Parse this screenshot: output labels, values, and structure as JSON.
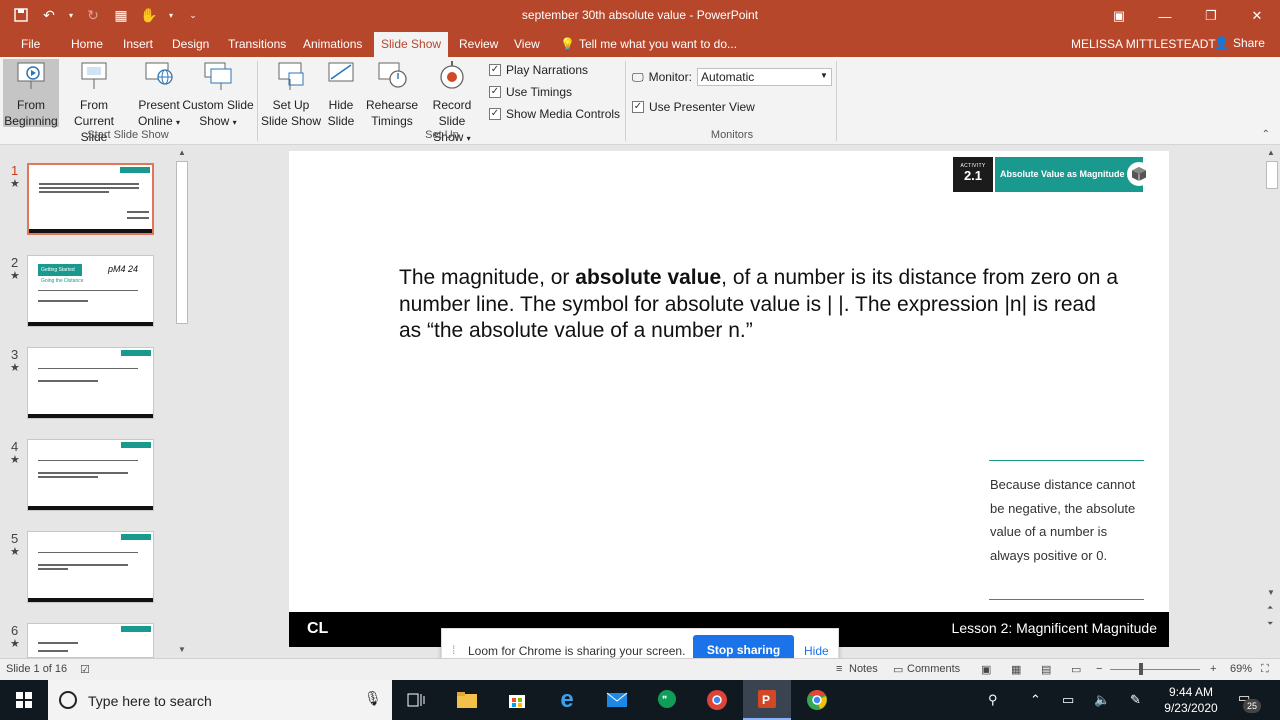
{
  "window": {
    "title": "september 30th absolute value - PowerPoint"
  },
  "menu": {
    "tabs": [
      "File",
      "Home",
      "Insert",
      "Design",
      "Transitions",
      "Animations",
      "Slide Show",
      "Review",
      "View"
    ],
    "active_tab": "Slide Show",
    "tell_me": "Tell me what you want to do...",
    "user": "MELISSA MITTLESTEADT",
    "share": "Share"
  },
  "ribbon": {
    "start": {
      "from_beginning": [
        "From",
        "Beginning"
      ],
      "from_current": [
        "From",
        "Current Slide"
      ],
      "present_online": [
        "Present",
        "Online"
      ],
      "custom_show": [
        "Custom Slide",
        "Show"
      ],
      "label": "Start Slide Show"
    },
    "setup": {
      "setup_show": [
        "Set Up",
        "Slide Show"
      ],
      "hide_slide": [
        "Hide",
        "Slide"
      ],
      "rehearse": [
        "Rehearse",
        "Timings"
      ],
      "record": [
        "Record Slide",
        "Show"
      ],
      "play_narrations": "Play Narrations",
      "use_timings": "Use Timings",
      "show_media": "Show Media Controls",
      "label": "Set Up"
    },
    "monitors": {
      "monitor_label": "Monitor:",
      "monitor_value": "Automatic",
      "presenter_view": "Use Presenter View",
      "label": "Monitors"
    }
  },
  "thumbnails": [
    {
      "num": "1"
    },
    {
      "num": "2",
      "heading": "Getting Started",
      "sub": "Going the Distance",
      "handwriting": "pM4 24"
    },
    {
      "num": "3"
    },
    {
      "num": "4"
    },
    {
      "num": "5"
    },
    {
      "num": "6"
    }
  ],
  "slide": {
    "activity_small": "ACTIVITY",
    "activity_num": "2.1",
    "activity_title": "Absolute Value as Magnitude",
    "text_before_bold": "The magnitude, or ",
    "text_bold": "absolute value",
    "text_after_bold": ", of a number is its distance from zero on a number line. The symbol for absolute value is | |. The expression |n| is read as “the absolute value of a number n.”",
    "note": "Because distance cannot be negative, the absolute value of a number is always positive or 0.",
    "footer_logo": "CL",
    "footer_lesson": "Lesson 2: Magnificent Magnitude"
  },
  "loom": {
    "message": "Loom for Chrome is sharing your screen.",
    "stop": "Stop sharing",
    "hide": "Hide"
  },
  "status": {
    "slide_count": "Slide 1 of 16",
    "notes": "Notes",
    "comments": "Comments",
    "zoom": "69%"
  },
  "taskbar": {
    "search_placeholder": "Type here to search",
    "time": "9:44 AM",
    "date": "9/23/2020",
    "notifications": "25"
  },
  "colors": {
    "accent": "#b7472a",
    "teal": "#1a9a8e",
    "loom_blue": "#1a73e8"
  }
}
